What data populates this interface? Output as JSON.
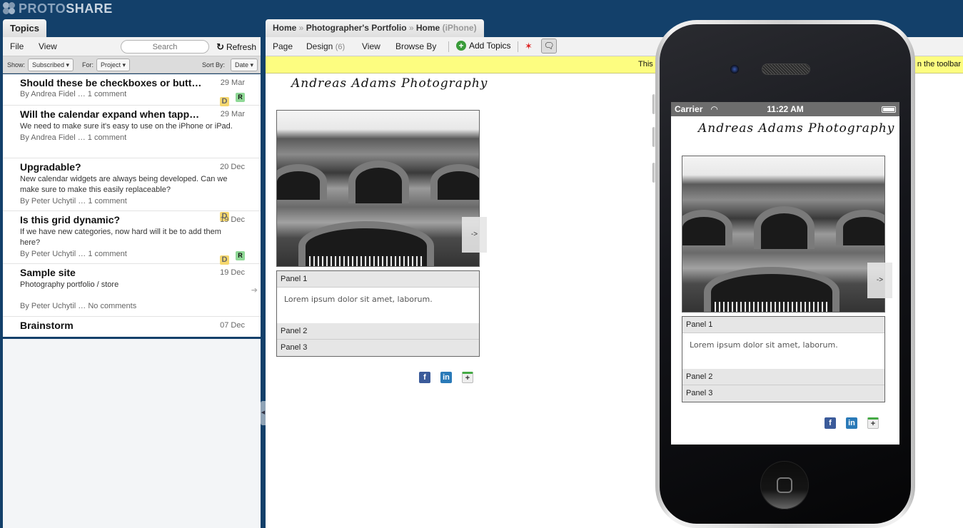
{
  "app": {
    "logo_part1": "PROTO",
    "logo_part2": "SHARE"
  },
  "topics_panel": {
    "tab_label": "Topics",
    "menu": {
      "file": "File",
      "view": "View"
    },
    "search_placeholder": "Search",
    "refresh_label": "Refresh",
    "filters": {
      "show_label": "Show:",
      "show_value": "Subscribed ▾",
      "for_label": "For:",
      "for_value": "Project ▾",
      "sort_label": "Sort By:",
      "sort_value": "Date ▾"
    },
    "topics": [
      {
        "title": "Should these be checkboxes or butt…",
        "date": "29 Mar",
        "desc": "",
        "byline": "By Andrea Fidel … 1 comment",
        "badges": [
          "D",
          "R"
        ]
      },
      {
        "title": "Will the calendar expand when tapp…",
        "date": "29 Mar",
        "desc": "We need to make sure it's easy to use on the iPhone or iPad.",
        "byline": "By Andrea Fidel … 1 comment",
        "badges": []
      },
      {
        "title": "Upgradable?",
        "date": "20 Dec",
        "desc": "New calendar widgets are always being developed. Can we make sure to make this easily replaceable?",
        "byline": "By Peter Uchytil … 1 comment",
        "badges": [
          "D"
        ]
      },
      {
        "title": "Is this grid dynamic?",
        "date": "19 Dec",
        "desc": "If we have new categories, now hard will it be to add them here?",
        "byline": "By Peter Uchytil … 1 comment",
        "badges": [
          "D",
          "R"
        ]
      },
      {
        "title": "Sample site",
        "date": "19 Dec",
        "desc": "Photography portfolio / store",
        "byline": "By Peter Uchytil … No comments",
        "badges": []
      },
      {
        "title": "Brainstorm",
        "date": "07 Dec",
        "desc": "",
        "byline": "",
        "badges": []
      }
    ]
  },
  "main": {
    "breadcrumb": {
      "home": "Home",
      "sep": " » ",
      "project": "Photographer's Portfolio",
      "page": "Home",
      "device": "(iPhone)"
    },
    "menu": {
      "page": "Page",
      "design": "Design",
      "design_count": "(6)",
      "view": "View",
      "browse_by": "Browse By",
      "add_topics": "Add Topics"
    },
    "notice": {
      "left": "This",
      "right": "n the toolbar"
    },
    "site": {
      "title": "Andreas Adams Photography",
      "next_label": "->",
      "panels": [
        "Panel 1",
        "Panel 2",
        "Panel 3"
      ],
      "panel_body": "Lorem ipsum dolor sit amet,  laborum.",
      "social": [
        "facebook",
        "linkedin",
        "google-plus"
      ]
    }
  },
  "iphone": {
    "carrier": "Carrier",
    "time": "11:22 AM"
  },
  "colors": {
    "frame": "#13406a",
    "notice": "#fdfd80",
    "badge_d": "#f5d76e",
    "badge_r": "#8fd896"
  }
}
